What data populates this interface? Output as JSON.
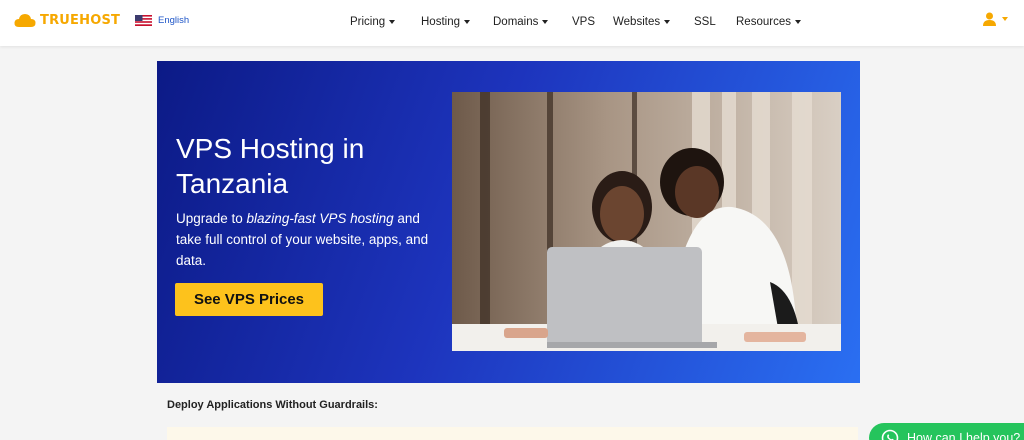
{
  "header": {
    "logo_text": "TRUEHOST",
    "language_label": "English",
    "nav": [
      {
        "label": "Pricing",
        "caret": true
      },
      {
        "label": "Hosting",
        "caret": true
      },
      {
        "label": "Domains",
        "caret": true
      },
      {
        "label": "VPS",
        "caret": false
      },
      {
        "label": "Websites",
        "caret": true
      },
      {
        "label": "SSL",
        "caret": false
      },
      {
        "label": "Resources",
        "caret": true
      }
    ],
    "user_icon": "user-icon"
  },
  "hero": {
    "title": "VPS Hosting in Tanzania",
    "subtitle_before": "Upgrade to ",
    "subtitle_em": "blazing-fast VPS hosting",
    "subtitle_after": " and take full control of your website, apps, and data.",
    "cta_label": "See VPS Prices"
  },
  "section": {
    "heading": "Deploy Applications Without Guardrails:"
  },
  "chat": {
    "label": "How can I help you?",
    "icon": "whatsapp-icon"
  },
  "colors": {
    "brand": "#f6a800",
    "link": "#1f56c8",
    "hero_start": "#0c1a86",
    "hero_end": "#2a6ff2",
    "cta": "#fdc21c",
    "chat": "#25c45c"
  }
}
